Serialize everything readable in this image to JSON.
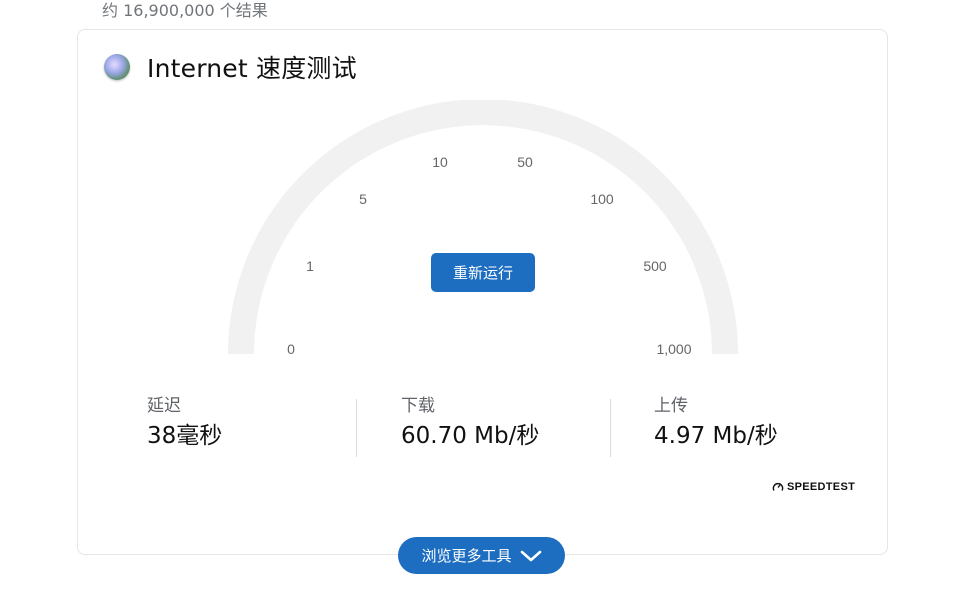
{
  "results": {
    "count_text": "约 16,900,000 个结果"
  },
  "card": {
    "title": "Internet 速度测试",
    "logo_icon": "speedtest-globe-icon"
  },
  "gauge": {
    "scale_labels": [
      "0",
      "1",
      "5",
      "10",
      "50",
      "100",
      "500",
      "1,000"
    ],
    "track_color": "#f1f1f1",
    "rerun_label": "重新运行"
  },
  "stats": {
    "latency": {
      "label": "延迟",
      "value": "38毫秒"
    },
    "download": {
      "label": "下载",
      "value": "60.70 Mb/秒"
    },
    "upload": {
      "label": "上传",
      "value": "4.97 Mb/秒"
    }
  },
  "branding": {
    "provider": "SPEEDTEST"
  },
  "more_tools": {
    "label": "浏览更多工具"
  },
  "colors": {
    "accent": "#1d6ec0"
  }
}
